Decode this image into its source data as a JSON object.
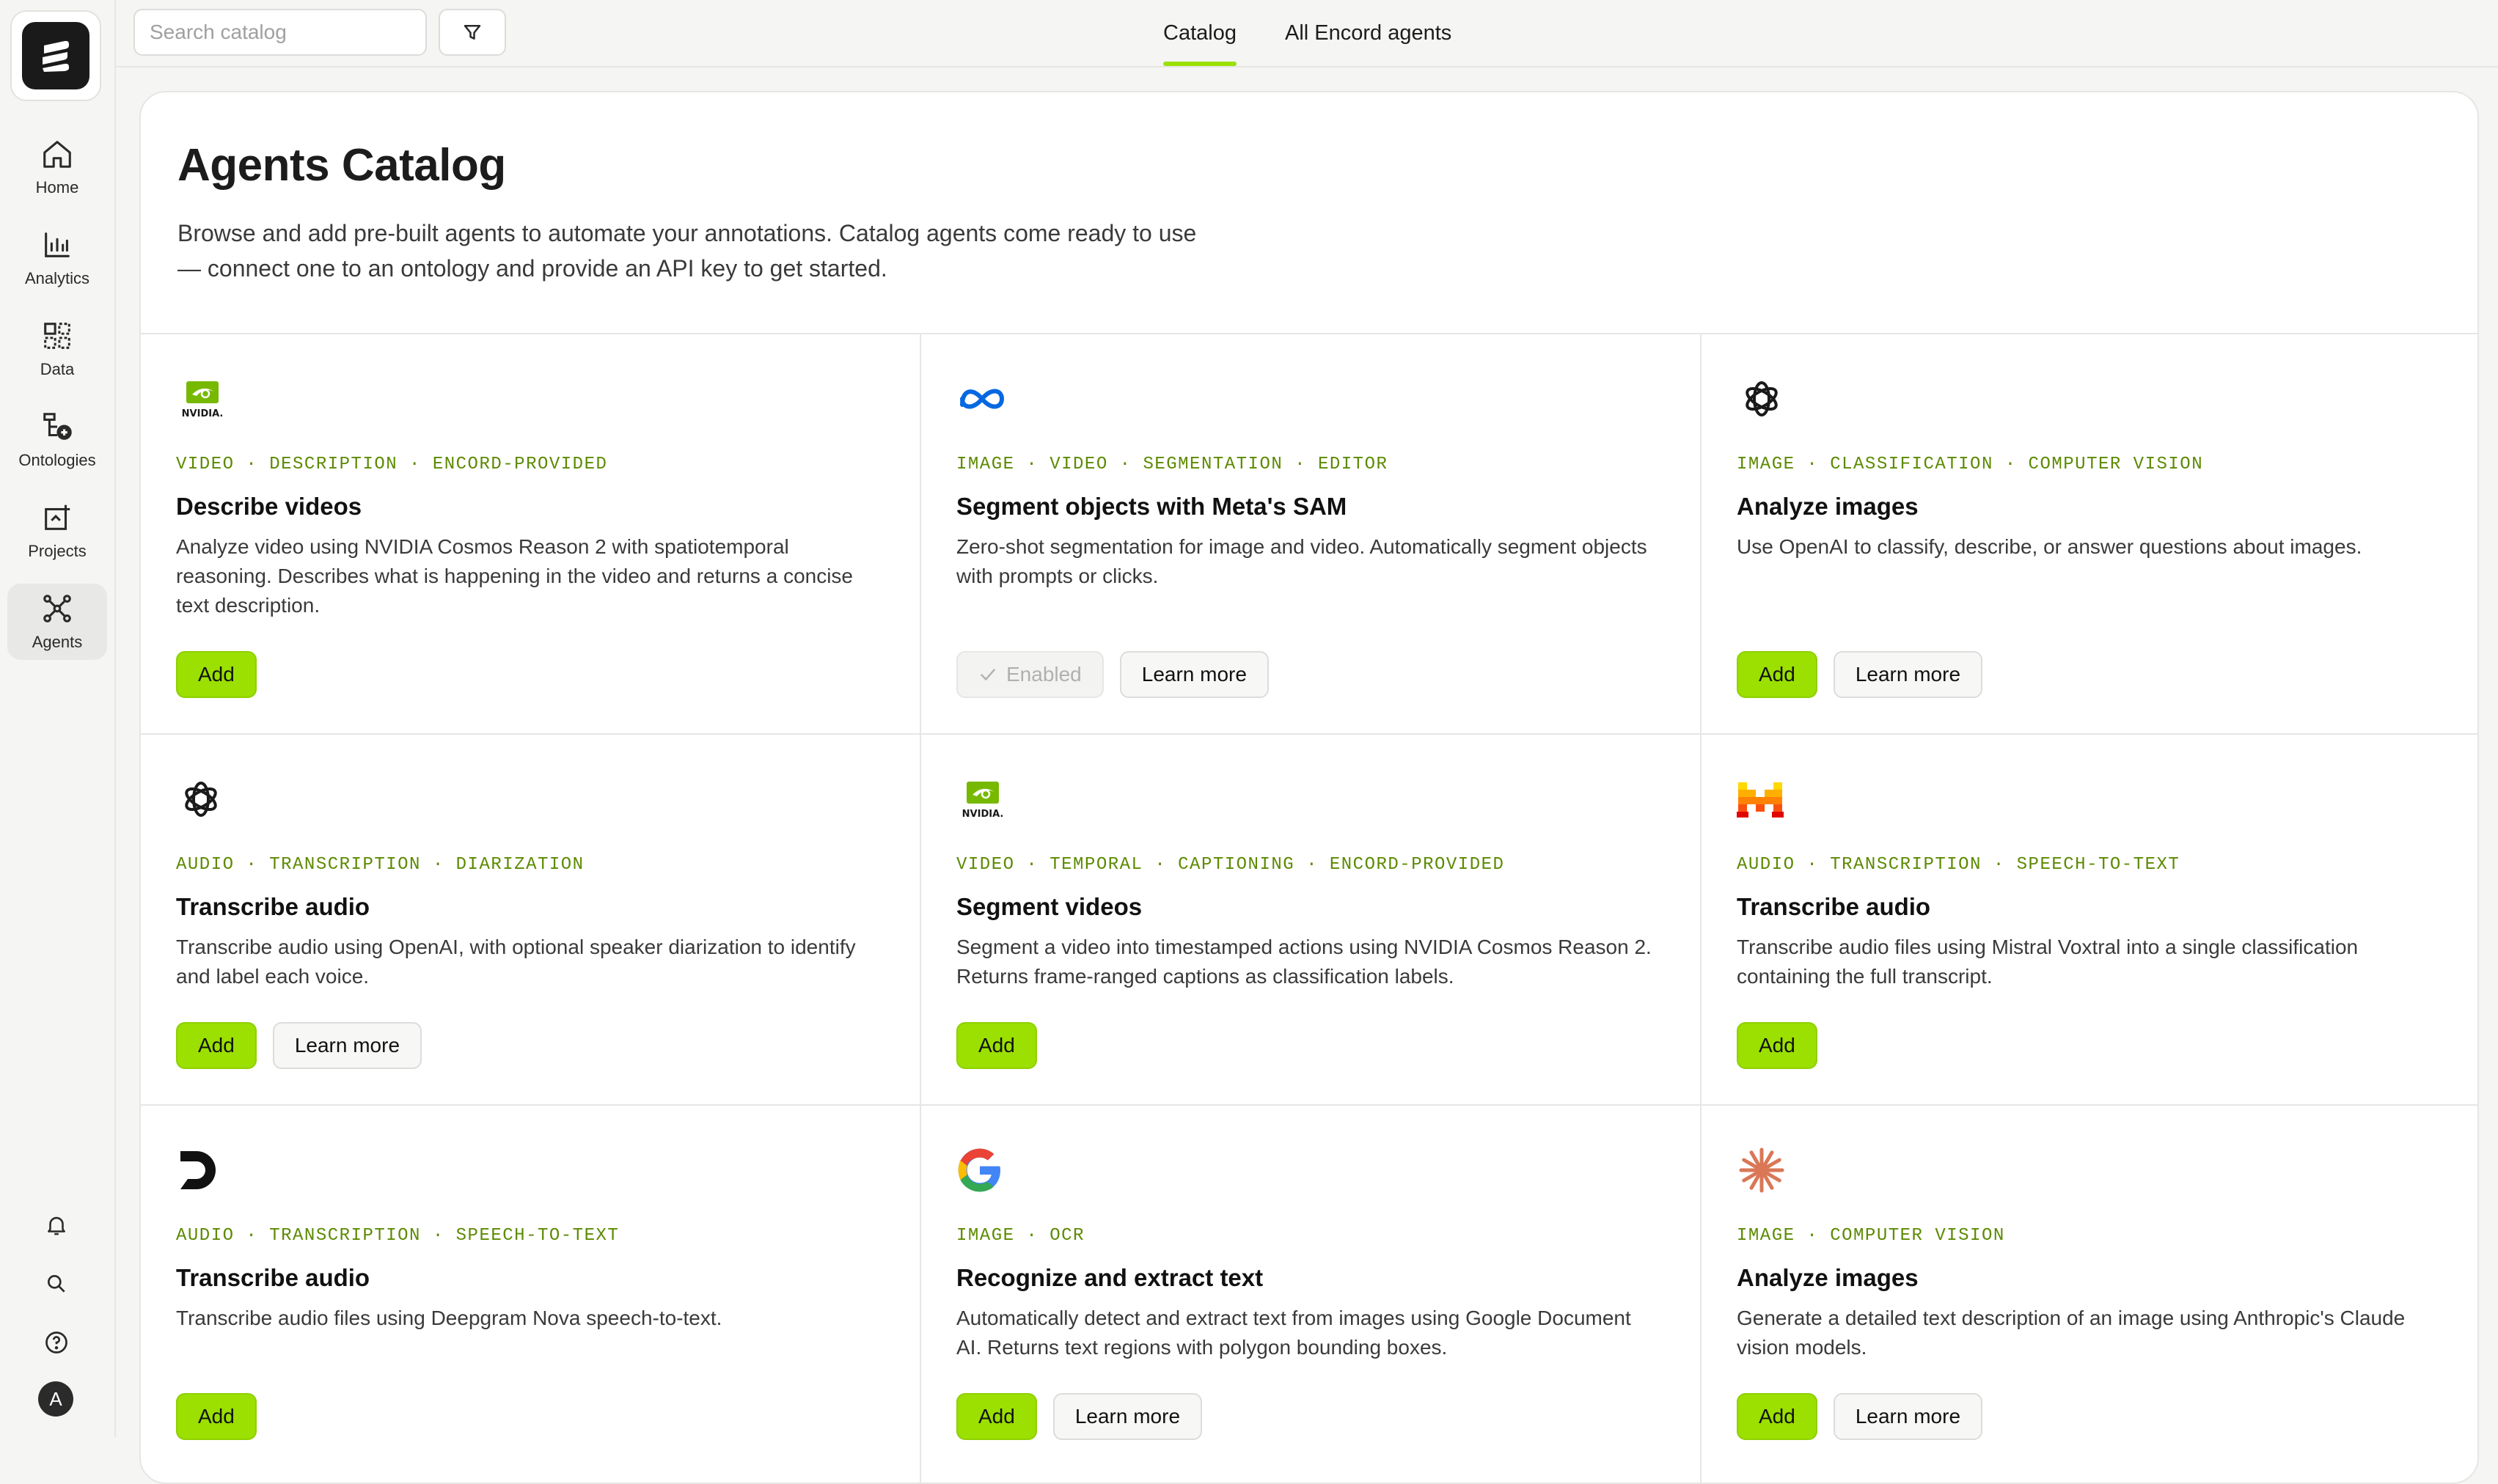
{
  "sidebar": {
    "items": [
      {
        "label": "Home",
        "icon": "home-icon"
      },
      {
        "label": "Analytics",
        "icon": "analytics-icon"
      },
      {
        "label": "Data",
        "icon": "data-icon"
      },
      {
        "label": "Ontologies",
        "icon": "ontologies-icon"
      },
      {
        "label": "Projects",
        "icon": "projects-icon"
      },
      {
        "label": "Agents",
        "icon": "agents-icon",
        "active": true
      }
    ],
    "avatar_initial": "A"
  },
  "topbar": {
    "search_placeholder": "Search catalog",
    "tabs": [
      {
        "label": "Catalog",
        "active": true
      },
      {
        "label": "All Encord agents",
        "active": false
      }
    ]
  },
  "page": {
    "title": "Agents Catalog",
    "description": "Browse and add pre-built agents to automate your annotations. Catalog agents come ready to use — connect one to an ontology and provide an API key to get started."
  },
  "buttons": {
    "add": "Add",
    "learn_more": "Learn more",
    "enabled": "Enabled"
  },
  "cards": [
    {
      "logo": "nvidia-logo",
      "tags": "VIDEO · DESCRIPTION · ENCORD-PROVIDED",
      "title": "Describe videos",
      "description": "Analyze video using NVIDIA Cosmos Reason 2 with spatiotemporal reasoning. Describes what is happening in the video and returns a concise text description.",
      "status": "add"
    },
    {
      "logo": "meta-logo",
      "tags": "IMAGE · VIDEO · SEGMENTATION · EDITOR",
      "title": "Segment objects with Meta's SAM",
      "description": "Zero-shot segmentation for image and video. Automatically segment objects with prompts or clicks.",
      "status": "enabled"
    },
    {
      "logo": "openai-logo",
      "tags": "IMAGE · CLASSIFICATION · COMPUTER VISION",
      "title": "Analyze images",
      "description": "Use OpenAI to classify, describe, or answer questions about images.",
      "status": "add"
    },
    {
      "logo": "openai-logo",
      "tags": "AUDIO · TRANSCRIPTION · DIARIZATION",
      "title": "Transcribe audio",
      "description": "Transcribe audio using OpenAI, with optional speaker diarization to identify and label each voice.",
      "status": "add"
    },
    {
      "logo": "nvidia-logo",
      "tags": "VIDEO · TEMPORAL · CAPTIONING · ENCORD-PROVIDED",
      "title": "Segment videos",
      "description": "Segment a video into timestamped actions using NVIDIA Cosmos Reason 2. Returns frame-ranged captions as classification labels.",
      "status": "add"
    },
    {
      "logo": "mistral-logo",
      "tags": "AUDIO · TRANSCRIPTION · SPEECH-TO-TEXT",
      "title": "Transcribe audio",
      "description": "Transcribe audio files using Mistral Voxtral into a single classification containing the full transcript.",
      "status": "add"
    },
    {
      "logo": "deepgram-logo",
      "tags": "AUDIO · TRANSCRIPTION · SPEECH-TO-TEXT",
      "title": "Transcribe audio",
      "description": "Transcribe audio files using Deepgram Nova speech-to-text.",
      "status": "add"
    },
    {
      "logo": "google-logo",
      "tags": "IMAGE · OCR",
      "title": "Recognize and extract text",
      "description": "Automatically detect and extract text from images using Google Document AI. Returns text regions with polygon bounding boxes.",
      "status": "add"
    },
    {
      "logo": "anthropic-logo",
      "tags": "IMAGE · COMPUTER VISION",
      "title": "Analyze images",
      "description": "Generate a detailed text description of an image using Anthropic's Claude vision models.",
      "status": "add"
    }
  ],
  "colors": {
    "accent": "#9be000",
    "tag_text": "#5c8a00",
    "background": "#f5f5f4"
  }
}
